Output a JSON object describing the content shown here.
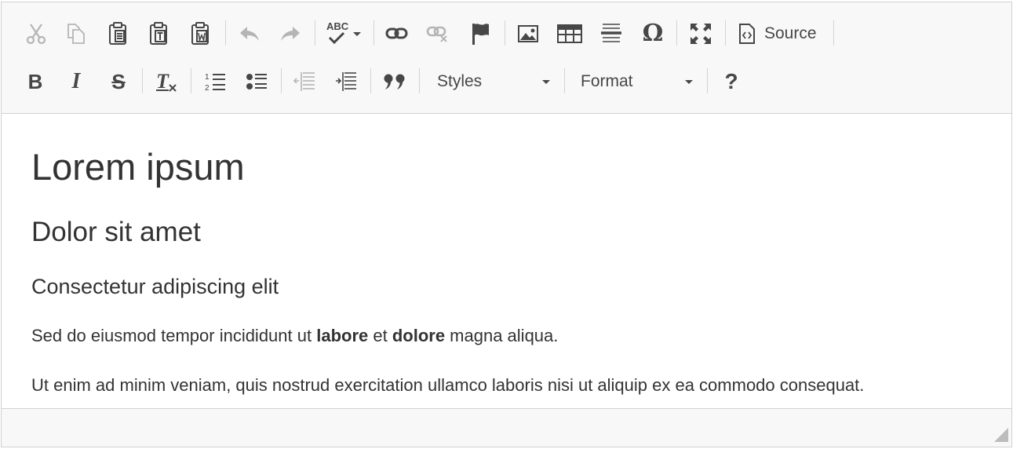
{
  "toolbar": {
    "row1": {
      "cut_icon": "scissors-icon",
      "copy_icon": "copy-icon",
      "paste_icon": "clipboard-icon",
      "paste_text_icon": "clipboard-text-icon",
      "paste_word_icon": "clipboard-word-icon",
      "undo_icon": "undo-icon",
      "redo_icon": "redo-icon",
      "spellcheck_label": "ABC",
      "link_icon": "link-icon",
      "unlink_icon": "unlink-icon",
      "anchor_icon": "flag-icon",
      "image_icon": "image-icon",
      "table_icon": "table-icon",
      "hline_icon": "horizontal-line-icon",
      "special_char": "Ω",
      "maximize_icon": "maximize-icon",
      "source_label": "Source"
    },
    "row2": {
      "bold": "B",
      "italic": "I",
      "strike": "S",
      "remove_format": "T",
      "numbered_list_icon": "numbered-list-icon",
      "bulleted_list_icon": "bulleted-list-icon",
      "outdent_icon": "outdent-icon",
      "indent_icon": "indent-icon",
      "blockquote": "❞",
      "styles_label": "Styles",
      "format_label": "Format",
      "help": "?"
    }
  },
  "content": {
    "h1": "Lorem ipsum",
    "h2": "Dolor sit amet",
    "h3": "Consectetur adipiscing elit",
    "p1": {
      "part1": "Sed do eiusmod tempor incididunt ut ",
      "bold1": "labore",
      "part2": " et ",
      "bold2": "dolore",
      "part3": " magna aliqua."
    },
    "p2": "Ut enim ad minim veniam, quis nostrud exercitation ullamco laboris nisi ut aliquip ex ea commodo consequat."
  },
  "colors": {
    "toolbar_bg": "#f8f8f8",
    "border": "#d1d1d1",
    "icon": "#474747",
    "icon_disabled": "#b5b5b5",
    "text": "#333333"
  }
}
